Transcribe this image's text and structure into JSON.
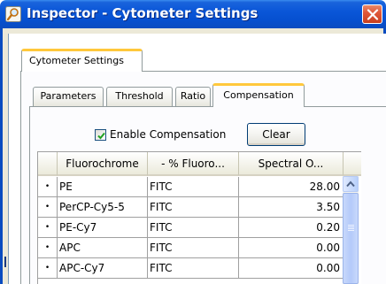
{
  "window": {
    "title": "Inspector - Cytometer Settings",
    "title_bar_color": "#0a56d8",
    "close_button_color": "#e0583a"
  },
  "outer_tabs": [
    {
      "label": "Cytometer Settings",
      "selected": true
    }
  ],
  "inner_tabs": [
    {
      "label": "Parameters",
      "selected": false
    },
    {
      "label": "Threshold",
      "selected": false
    },
    {
      "label": "Ratio",
      "selected": false
    },
    {
      "label": "Compensation",
      "selected": true
    }
  ],
  "compensation": {
    "enable_label": "Enable Compensation",
    "enable_checked": true,
    "clear_label": "Clear"
  },
  "grid": {
    "columns": [
      "",
      "Fluorochrome",
      "- % Fluoro...",
      "Spectral O..."
    ],
    "rows": [
      {
        "marker": "•",
        "fluorochrome": "PE",
        "minus_fluoro": "FITC",
        "spectral": "28.00"
      },
      {
        "marker": "•",
        "fluorochrome": "PerCP-Cy5-5",
        "minus_fluoro": "FITC",
        "spectral": "3.50"
      },
      {
        "marker": "•",
        "fluorochrome": "PE-Cy7",
        "minus_fluoro": "FITC",
        "spectral": "0.20"
      },
      {
        "marker": "•",
        "fluorochrome": "APC",
        "minus_fluoro": "FITC",
        "spectral": "0.00"
      },
      {
        "marker": "•",
        "fluorochrome": "APC-Cy7",
        "minus_fluoro": "FITC",
        "spectral": "0.00"
      }
    ]
  },
  "icons": {
    "title": "inspector-icon",
    "close": "close-icon",
    "checkbox": "checkmark-icon",
    "scroll_up": "scroll-up-arrow-icon"
  }
}
